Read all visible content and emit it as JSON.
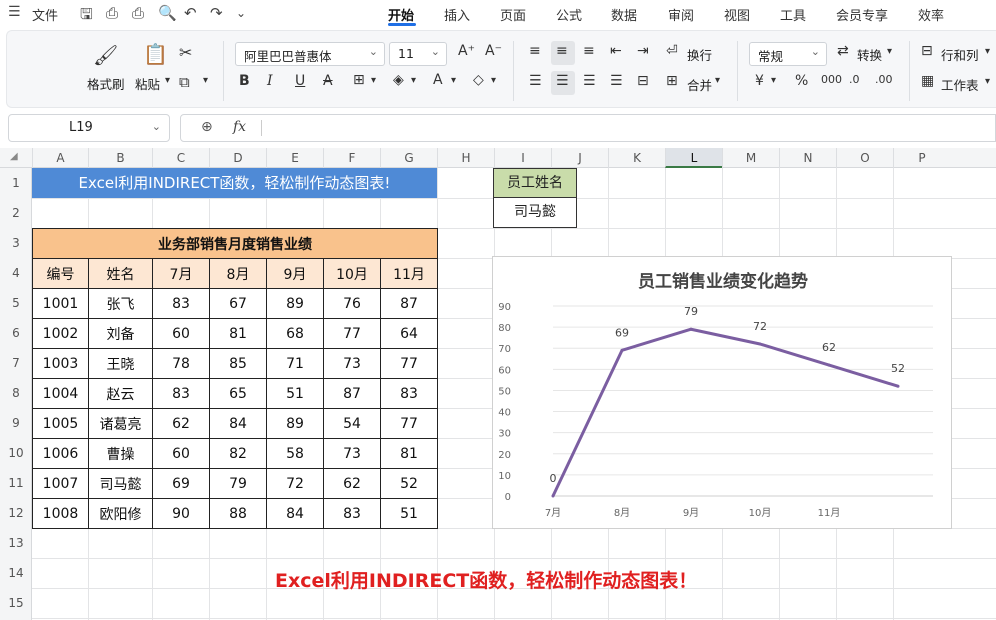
{
  "menubar": {
    "file": "文件",
    "tabs": [
      "开始",
      "插入",
      "页面",
      "公式",
      "数据",
      "审阅",
      "视图",
      "工具",
      "会员专享",
      "效率"
    ]
  },
  "ribbon": {
    "format_painter": "格式刷",
    "paste": "粘贴",
    "font_name": "阿里巴巴普惠体",
    "font_size": "11",
    "wrap": "换行",
    "merge": "合并",
    "number_format": "常规",
    "convert": "转换",
    "rows_cols": "行和列",
    "worksheet": "工作表"
  },
  "formula_bar": {
    "cell_ref": "L19",
    "fx": "fx"
  },
  "columns": [
    "A",
    "B",
    "C",
    "D",
    "E",
    "F",
    "G",
    "H",
    "I",
    "J",
    "K",
    "L",
    "M",
    "N",
    "O",
    "P"
  ],
  "active_column": "L",
  "rows": [
    "1",
    "2",
    "3",
    "4",
    "5",
    "6",
    "7",
    "8",
    "9",
    "10",
    "11",
    "12",
    "13",
    "14",
    "15"
  ],
  "sheet": {
    "banner": "Excel利用INDIRECT函数，轻松制作动态图表!",
    "table_caption": "业务部销售月度销售业绩",
    "headers": [
      "编号",
      "姓名",
      "7月",
      "8月",
      "9月",
      "10月",
      "11月"
    ],
    "records": [
      [
        "1001",
        "张飞",
        "83",
        "67",
        "89",
        "76",
        "87"
      ],
      [
        "1002",
        "刘备",
        "60",
        "81",
        "68",
        "77",
        "64"
      ],
      [
        "1003",
        "王晓",
        "78",
        "85",
        "71",
        "73",
        "77"
      ],
      [
        "1004",
        "赵云",
        "83",
        "65",
        "51",
        "87",
        "83"
      ],
      [
        "1005",
        "诸葛亮",
        "62",
        "84",
        "89",
        "54",
        "77"
      ],
      [
        "1006",
        "曹操",
        "60",
        "82",
        "58",
        "73",
        "81"
      ],
      [
        "1007",
        "司马懿",
        "69",
        "79",
        "72",
        "62",
        "52"
      ],
      [
        "1008",
        "欧阳修",
        "90",
        "88",
        "84",
        "83",
        "51"
      ]
    ],
    "employee_label": "员工姓名",
    "employee_value": "司马懿",
    "bottom_note": "Excel利用INDIRECT函数，轻松制作动态图表！"
  },
  "chart_data": {
    "type": "line",
    "title": "员工销售业绩变化趋势",
    "categories": [
      "7月",
      "8月",
      "9月",
      "10月",
      "11月"
    ],
    "values": [
      0,
      69,
      79,
      72,
      62,
      52
    ],
    "data_labels": [
      "0",
      "69",
      "79",
      "72",
      "62",
      "52"
    ],
    "ylim": [
      0,
      90
    ],
    "yticks": [
      "0",
      "10",
      "20",
      "30",
      "40",
      "50",
      "60",
      "70",
      "80",
      "90"
    ],
    "grid": true,
    "line_color": "#7b5ea1"
  }
}
